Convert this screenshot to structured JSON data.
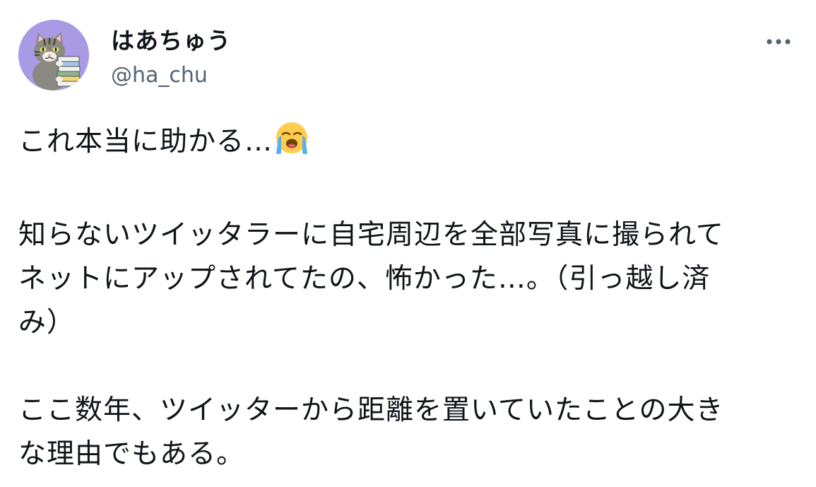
{
  "tweet": {
    "author": {
      "display_name": "はあちゅう",
      "handle": "@ha_chu",
      "avatar_icon": "cat-with-books-avatar",
      "avatar_color": "#a99ae6"
    },
    "more_icon": "more-options-icon",
    "paragraphs": [
      {
        "text": "これ本当に助かる…",
        "emoji": "loudly-crying-face-icon"
      },
      {
        "text": "知らないツイッタラーに自宅周辺を全部写真に撮られて\nネットにアップされてたの、怖かった…。（引っ越し済\nみ）"
      },
      {
        "text": "ここ数年、ツイッターから距離を置いていたことの大き\nな理由でもある。"
      }
    ]
  },
  "colors": {
    "text_primary": "#0f1419",
    "text_secondary": "#536471",
    "background": "#ffffff"
  }
}
